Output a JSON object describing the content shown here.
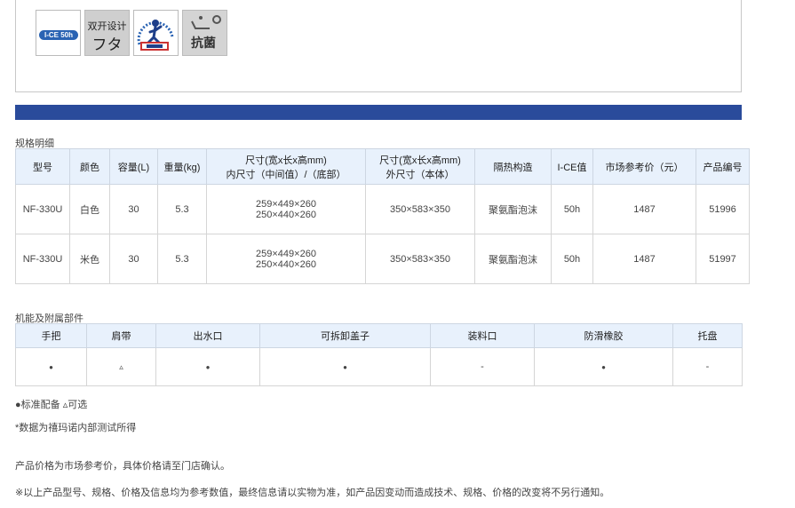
{
  "icons": {
    "ice_label": "I-CE 50h",
    "lid_line1": "双开设计",
    "lid_line2": "フタ",
    "antibac_label": "抗菌"
  },
  "spec": {
    "title": "规格明细",
    "headers": {
      "model": "型号",
      "color": "颜色",
      "capacity": "容量(L)",
      "weight": "重量(kg)",
      "dim_in_1": "尺寸(宽x长x高mm)",
      "dim_in_2": "内尺寸（中间值）/（底部）",
      "dim_out_1": "尺寸(宽x长x高mm)",
      "dim_out_2": "外尺寸（本体）",
      "insulation": "隔热构造",
      "ice": "I-CE值",
      "price": "市场参考价（元）",
      "code": "产品编号"
    },
    "rows": [
      {
        "model": "NF-330U",
        "color": "白色",
        "capacity": "30",
        "weight": "5.3",
        "dim_in_1": "259×449×260",
        "dim_in_2": "250×440×260",
        "dim_out": "350×583×350",
        "insulation": "聚氨酯泡沫",
        "ice": "50h",
        "price": "1487",
        "code": "51996"
      },
      {
        "model": "NF-330U",
        "color": "米色",
        "capacity": "30",
        "weight": "5.3",
        "dim_in_1": "259×449×260",
        "dim_in_2": "250×440×260",
        "dim_out": "350×583×350",
        "insulation": "聚氨酯泡沫",
        "ice": "50h",
        "price": "1487",
        "code": "51997"
      }
    ]
  },
  "features": {
    "title": "机能及附属部件",
    "headers": [
      "手把",
      "肩带",
      "出水口",
      "可拆卸盖子",
      "装料口",
      "防滑橡胶",
      "托盘"
    ],
    "values": [
      "●",
      "▵",
      "●",
      "●",
      "-",
      "●",
      "-"
    ]
  },
  "notes": {
    "legend": "●标准配备 ▵可选",
    "data_source": "*数据为禧玛诺内部测试所得",
    "price_note": "产品价格为市场参考价，具体价格请至门店确认。",
    "disclaimer": "※以上产品型号、规格、价格及信息均为参考数值，最终信息请以实物为准，如产品因变动而造成技术、规格、价格的改变将不另行通知。"
  }
}
